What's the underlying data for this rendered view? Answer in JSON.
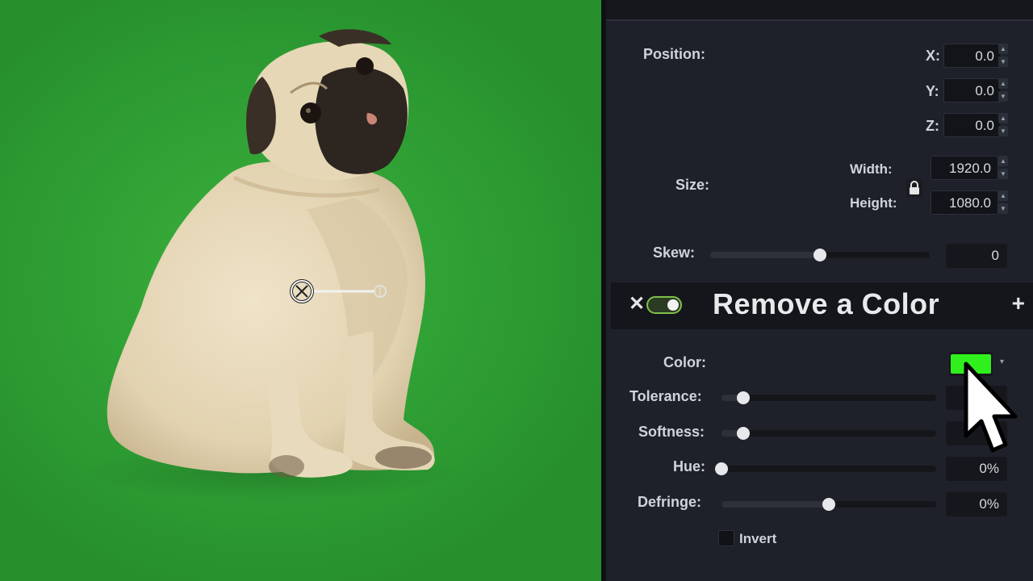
{
  "panel": {
    "position_label": "Position:",
    "x_label": "X:",
    "x_value": "0.0",
    "y_label": "Y:",
    "y_value": "0.0",
    "z_label": "Z:",
    "z_value": "0.0",
    "size_label": "Size:",
    "width_label": "Width:",
    "width_value": "1920.0",
    "height_label": "Height:",
    "height_value": "1080.0",
    "skew_label": "Skew:",
    "skew_value": "0",
    "skew_level": 0.5
  },
  "effect": {
    "title": "Remove a Color",
    "enabled": true,
    "color_label": "Color:",
    "color_value": "#2ff01c",
    "tolerance_label": "Tolerance:",
    "tolerance_level": 0.1,
    "softness_label": "Softness:",
    "softness_level": 0.1,
    "hue_label": "Hue:",
    "hue_value": "0%",
    "hue_level": 0.0,
    "defringe_label": "Defringe:",
    "defringe_value": "0%",
    "defringe_level": 0.5,
    "invert_label": "Invert"
  },
  "colors": {
    "screen_green": "#33a838",
    "panel_bg": "#1e212a",
    "accent_green": "#7fbf4a"
  },
  "icons": [
    "lock-icon",
    "close-icon",
    "toggle-switch",
    "plus-icon",
    "mouse-pointer-icon",
    "rotation-handle-icon"
  ]
}
